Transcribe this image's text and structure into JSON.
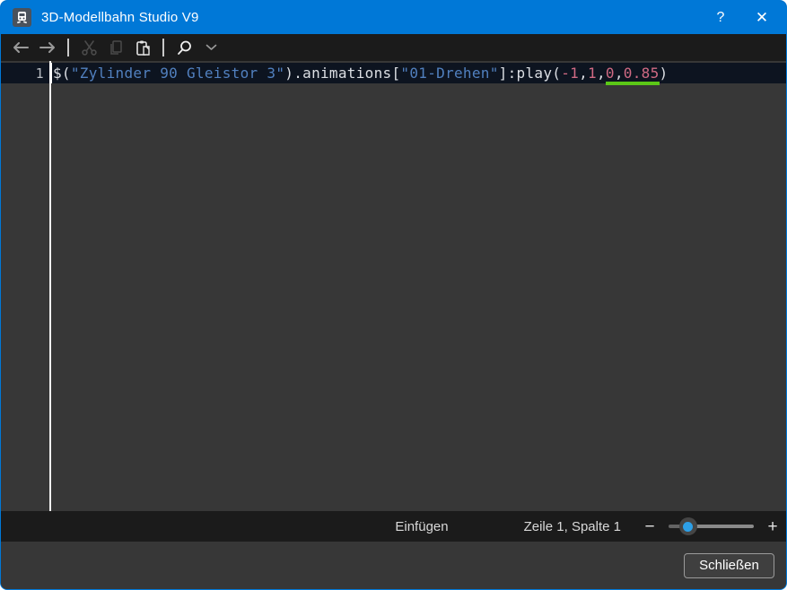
{
  "window": {
    "title": "3D-Modellbahn Studio V9",
    "help_label": "?",
    "close_label": "✕",
    "accent_color": "#0078d7"
  },
  "toolbar": {
    "icons": [
      {
        "name": "back",
        "enabled": true
      },
      {
        "name": "forward",
        "enabled": true
      },
      {
        "name": "cut",
        "enabled": false
      },
      {
        "name": "copy",
        "enabled": false
      },
      {
        "name": "paste",
        "enabled": true
      },
      {
        "name": "search",
        "enabled": true
      },
      {
        "name": "search-dropdown",
        "enabled": true
      }
    ]
  },
  "editor": {
    "line_number": "1",
    "cursor": {
      "line": 1,
      "column": 1
    },
    "code_line": {
      "tokens": [
        {
          "text": "$(",
          "type": "default"
        },
        {
          "text": "\"Zylinder 90 Gleistor 3\"",
          "type": "string"
        },
        {
          "text": ").animations[",
          "type": "default"
        },
        {
          "text": "\"01-Drehen\"",
          "type": "string"
        },
        {
          "text": "]:play(",
          "type": "default"
        },
        {
          "text": "-1",
          "type": "number"
        },
        {
          "text": ",",
          "type": "default"
        },
        {
          "text": "1",
          "type": "number"
        },
        {
          "text": ",",
          "type": "default"
        },
        {
          "text": "0",
          "type": "number",
          "underline": true
        },
        {
          "text": ",",
          "type": "default",
          "underline": true
        },
        {
          "text": "0.85",
          "type": "number",
          "underline": true
        },
        {
          "text": ")",
          "type": "default"
        }
      ]
    },
    "colors": {
      "background": "#373737",
      "current_line_background": "#0d1420",
      "string_token": "#5180bf",
      "number_token": "#d06a84",
      "green_underline": "#5bc717"
    }
  },
  "status_bar": {
    "insert_mode": "Einfügen",
    "caret_position": "Zeile 1, Spalte 1",
    "zoom_out_label": "−",
    "zoom_in_label": "+",
    "zoom_slider_percent": 23
  },
  "footer": {
    "close_button": "Schließen"
  }
}
